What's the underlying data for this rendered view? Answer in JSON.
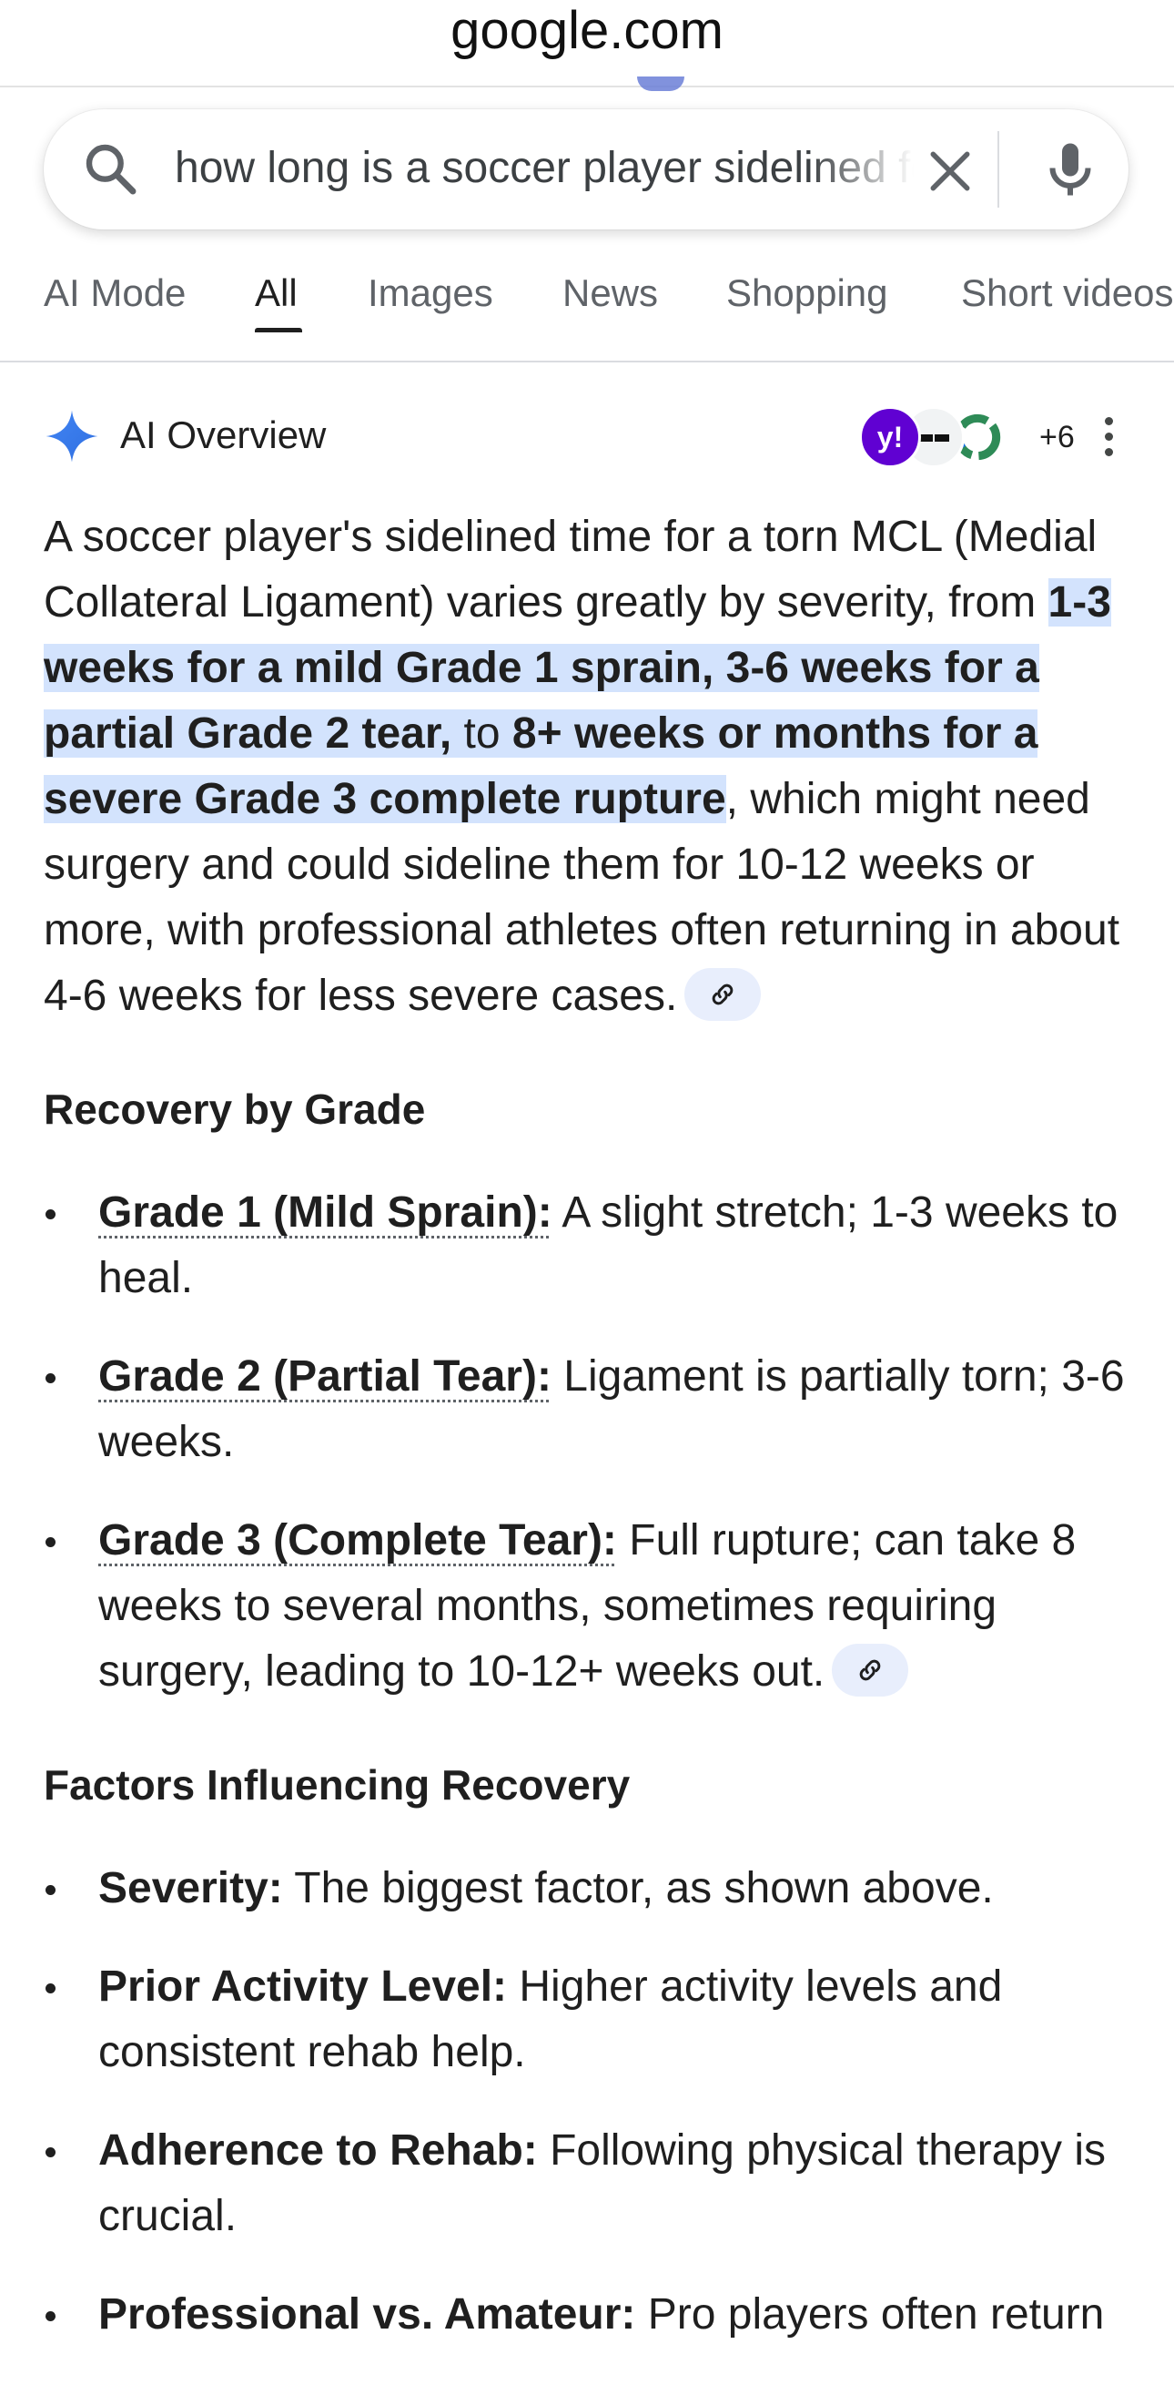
{
  "browser": {
    "domain": "google.com"
  },
  "search": {
    "query": "how long is a soccer player sidelined for a torn MCL"
  },
  "tabs": [
    {
      "label": "AI Mode"
    },
    {
      "label": "All",
      "active": true
    },
    {
      "label": "Images"
    },
    {
      "label": "News"
    },
    {
      "label": "Shopping"
    },
    {
      "label": "Short videos"
    }
  ],
  "ai_overview": {
    "title": "AI Overview",
    "source_icons": [
      "yahoo-logo",
      "dash-logo",
      "ring-logo"
    ],
    "more_sources": "+6",
    "summary": {
      "lead": "A soccer player's sidelined time for a torn MCL (Medial Collateral Ligament) varies greatly by severity, from ",
      "highlight_1": "1-3 weeks for a mild Grade 1 sprain, 3-6 weeks for a partial Grade 2 tear,",
      "highlight_mid": " to ",
      "highlight_2": "8+ weeks or months for a severe Grade 3 complete rupture",
      "tail": ", which might need surgery and could sideline them for 10-12 weeks or more, with professional athletes often returning in about 4-6 weeks for less severe cases."
    },
    "sections": [
      {
        "heading": "Recovery by Grade",
        "items": [
          {
            "term": "Grade 1 (Mild Sprain):",
            "text": " A slight stretch; 1-3 weeks to heal."
          },
          {
            "term": "Grade 2 (Partial Tear):",
            "text": " Ligament is partially torn; 3-6 weeks."
          },
          {
            "term": "Grade 3 (Complete Tear):",
            "text": " Full rupture; can take 8 weeks to several months, sometimes requiring surgery, leading to 10-12+ weeks out."
          }
        ]
      },
      {
        "heading": "Factors Influencing Recovery",
        "items": [
          {
            "term": "Severity:",
            "text": " The biggest factor, as shown above."
          },
          {
            "term": "Prior Activity Level:",
            "text": " Higher activity levels and consistent rehab help."
          },
          {
            "term": "Adherence to Rehab:",
            "text": " Following physical therapy is crucial."
          },
          {
            "term": "Professional vs. Amateur:",
            "text": " Pro players often return"
          }
        ]
      }
    ]
  },
  "colors": {
    "highlight": "#d3e3fd",
    "link_chip": "#e8eefc",
    "yahoo": "#6001d2",
    "sparkle": "#4285f4"
  }
}
